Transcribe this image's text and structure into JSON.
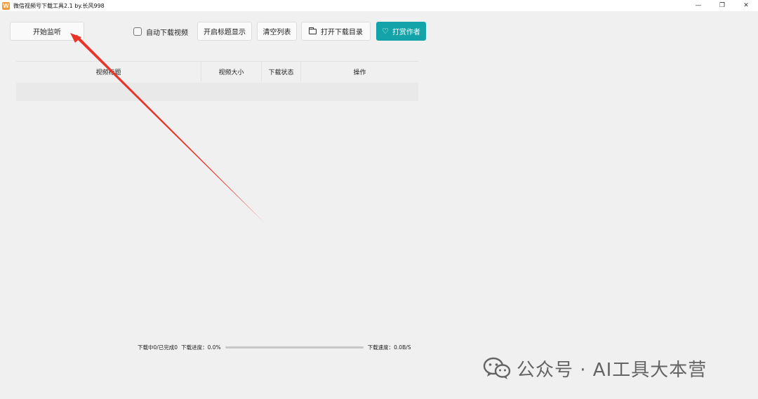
{
  "window": {
    "title": "微信视频号下载工具2.1 by.长风998",
    "icon_label": "W",
    "controls": {
      "minimize": "—",
      "maximize": "❐",
      "close": "✕"
    }
  },
  "toolbar": {
    "start_label": "开始监听",
    "auto_download_label": "自动下载视频",
    "auto_download_checked": false,
    "show_title_label": "开启标题显示",
    "clear_list_label": "清空列表",
    "open_dir_label": "打开下载目录",
    "reward_label": "打赏作者",
    "reward_color": "#14a3a8"
  },
  "table": {
    "columns": [
      "视频标题",
      "视频大小",
      "下载状态",
      "操作"
    ]
  },
  "status": {
    "counts": "下载中0/已完成0",
    "progress_label": "下载进度：0.0%",
    "progress_value": 0,
    "speed_label": "下载速度：0.0B/S"
  },
  "annotation": {
    "arrow_color": "#e8352a"
  },
  "watermark": {
    "text": "公众号 · AI工具大本营",
    "icon": "wechat-icon"
  }
}
